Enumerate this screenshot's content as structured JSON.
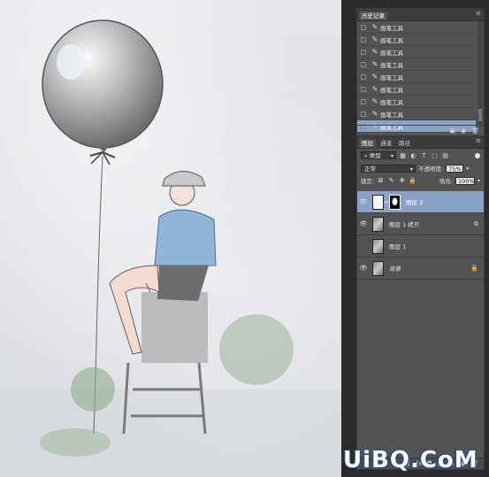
{
  "history_panel": {
    "tabs": [
      "历史记录"
    ],
    "items": [
      "画笔工具",
      "画笔工具",
      "画笔工具",
      "画笔工具",
      "画笔工具",
      "画笔工具",
      "画笔工具",
      "画笔工具",
      "画笔工具"
    ],
    "selected_index": 8
  },
  "layers_panel": {
    "tabs": [
      "图层",
      "通道",
      "路径"
    ],
    "filter_label": "类型",
    "blend_mode": "正常",
    "opacity_label": "不透明度:",
    "opacity_value": "75%",
    "lock_label": "锁定:",
    "fill_label": "填充:",
    "fill_value": "100%",
    "layers": [
      {
        "name": "图层 2",
        "visible": true,
        "selected": true
      },
      {
        "name": "图层 1 拷贝",
        "visible": true,
        "selected": false
      },
      {
        "name": "图层 1",
        "visible": false,
        "selected": false
      },
      {
        "name": "背景",
        "visible": true,
        "selected": false
      }
    ]
  },
  "watermark": "UiBQ.CoM",
  "colors": {
    "selection": "#8aa2c8",
    "panel_bg": "#535353",
    "tab_bg": "#3d3d3d"
  }
}
